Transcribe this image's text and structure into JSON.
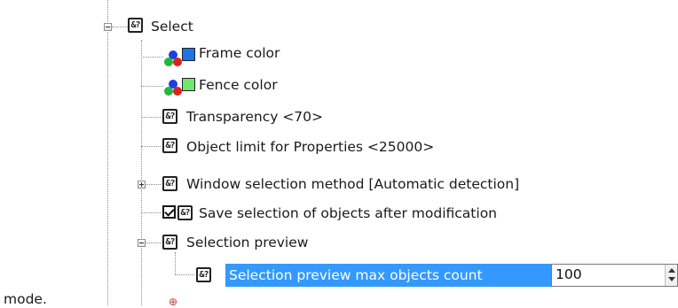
{
  "tree": {
    "select": {
      "label": "Select",
      "expander_state": "collapse"
    },
    "items": [
      {
        "label": "Frame color",
        "icon": "rgb-icon",
        "swatch_color": "#1e73e8"
      },
      {
        "label": "Fence color",
        "icon": "rgb-icon",
        "swatch_color": "#6ee86e"
      },
      {
        "label": "Transparency <70>",
        "icon": "property-icon"
      },
      {
        "label": "Object limit for Properties <25000>",
        "icon": "property-icon"
      },
      {
        "label": "Window selection method [Automatic detection]",
        "icon": "property-icon",
        "expander_state": "expand"
      },
      {
        "label": "Save selection of objects after modification",
        "icon": "property-icon",
        "checked": true
      },
      {
        "label": "Selection preview",
        "icon": "property-icon",
        "expander_state": "collapse"
      }
    ],
    "selected_child": {
      "label": "Selection preview max objects count",
      "icon": "property-icon",
      "value": "100"
    }
  },
  "left_text": "mode.",
  "colors": {
    "selection": "#3399ff"
  }
}
